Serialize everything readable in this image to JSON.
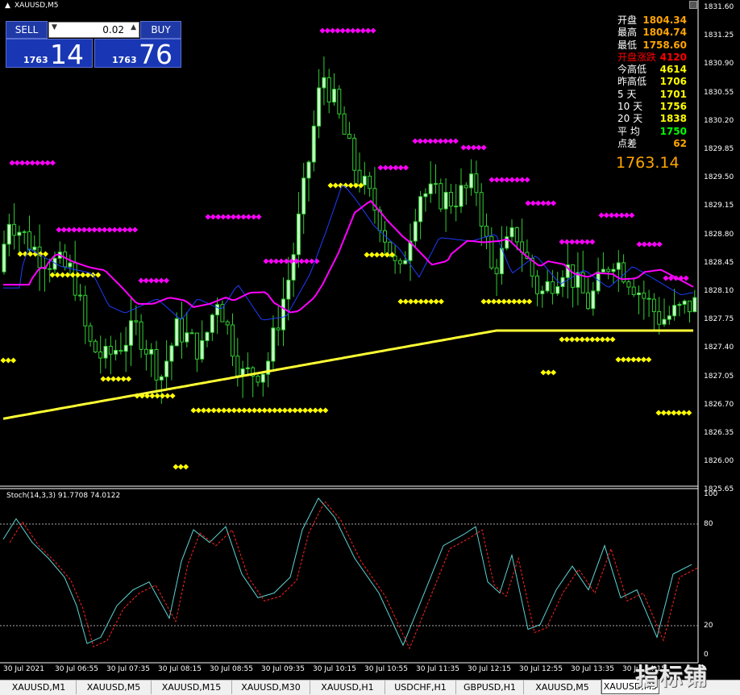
{
  "window": {
    "title": "XAUUSD,M5"
  },
  "trade_panel": {
    "sell_label": "SELL",
    "buy_label": "BUY",
    "lot": "0.02",
    "sell_price_small": "1763",
    "sell_price_big": "14",
    "buy_price_small": "1763",
    "buy_price_big": "76"
  },
  "info_panel": {
    "rows": [
      {
        "label": "开盘",
        "value": "1804.34",
        "color": "#ffa500"
      },
      {
        "label": "最高",
        "value": "1804.74",
        "color": "#ffa500"
      },
      {
        "label": "最低",
        "value": "1758.60",
        "color": "#ffa500"
      },
      {
        "label": "开盘涨跌",
        "value": "4120",
        "color": "#ff0000"
      },
      {
        "label": "今高低",
        "value": "4614",
        "color": "#ffff00"
      },
      {
        "label": "昨高低",
        "value": "1706",
        "color": "#ffff00"
      },
      {
        "label": "5  天",
        "value": "1701",
        "color": "#ffff00"
      },
      {
        "label": "10 天",
        "value": "1756",
        "color": "#ffff00"
      },
      {
        "label": "20 天",
        "value": "1838",
        "color": "#ffff00"
      },
      {
        "label": "平 均",
        "value": "1750",
        "color": "#00ff00"
      },
      {
        "label": "点差",
        "value": "62",
        "color": "#ffa500"
      }
    ],
    "current_price": "1763.14"
  },
  "price_axis": [
    "1831.60",
    "1831.25",
    "1830.90",
    "1830.55",
    "1830.20",
    "1829.85",
    "1829.50",
    "1829.15",
    "1828.80",
    "1828.45",
    "1828.10",
    "1827.75",
    "1827.40",
    "1827.05",
    "1826.70",
    "1826.35",
    "1826.00",
    "1825.65"
  ],
  "stoch": {
    "label": "Stoch(14,3,3) 91.7708 74.0122",
    "levels": [
      "100",
      "80",
      "20",
      "0"
    ]
  },
  "time_axis": [
    "30 Jul 2021",
    "30 Jul 06:55",
    "30 Jul 07:35",
    "30 Jul 08:15",
    "30 Jul 08:55",
    "30 Jul 09:35",
    "30 Jul 10:15",
    "30 Jul 10:55",
    "30 Jul 11:35",
    "30 Jul 12:15",
    "30 Jul 12:55",
    "30 Jul 13:35",
    "30 Jul 14:15"
  ],
  "tabs": [
    "XAUUSD,M1",
    "XAUUSD,M5",
    "XAUUSD,M15",
    "XAUUSD,M30",
    "XAUUSD,H1",
    "USDCHF,H1",
    "GBPUSD,H1",
    "XAUUSD,M5",
    "XAUUSD,M5"
  ],
  "active_tab_index": 8,
  "watermark": "指标铺",
  "colors": {
    "ma_fast": "#ff00ff",
    "ma_slow": "#ffff00",
    "ma_blue": "#1e3cff",
    "candle_up": "#c8ffc8",
    "wick": "#32cd32",
    "stoch_main": "#5fd3d3",
    "stoch_signal": "#ff2020"
  },
  "chart_data": {
    "type": "candlestick",
    "ylim": [
      1825.65,
      1831.6
    ],
    "stoch_ylim": [
      0,
      100
    ]
  }
}
